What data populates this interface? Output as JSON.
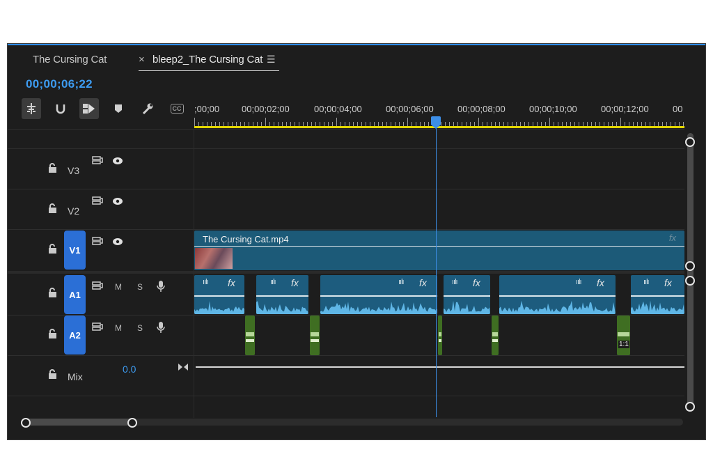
{
  "tabs": [
    {
      "label": "The Cursing Cat"
    },
    {
      "close": "×",
      "label": "bleep2_The Cursing Cat",
      "menu": "☰"
    }
  ],
  "timecode": "00;00;06;22",
  "toolbar": {
    "icons": [
      "insert-snap-icon",
      "magnet-icon",
      "linked-selection-icon",
      "marker-icon",
      "wrench-icon",
      "captions-icon"
    ],
    "cc_label": "CC"
  },
  "ruler": {
    "ticks": [
      ";00;00",
      "00;00;02;00",
      "00;00;04;00",
      "00;00;06;00",
      "00;00;08;00",
      "00;00;10;00",
      "00;00;12;00",
      "00"
    ]
  },
  "tracks": {
    "v3": {
      "name": "V3"
    },
    "v2": {
      "name": "V2"
    },
    "v1": {
      "name": "V1"
    },
    "a1": {
      "name": "A1",
      "m": "M",
      "s": "S"
    },
    "a2": {
      "name": "A2",
      "m": "M",
      "s": "S"
    },
    "mix": {
      "name": "Mix",
      "value": "0.0"
    }
  },
  "video_clip": {
    "name": "The Cursing Cat.mp4",
    "fx": "fx"
  },
  "audio_clip_fx": "fx",
  "audio_clip_badge": "1:1",
  "colors": {
    "accent": "#2d8ceb",
    "track_selected": "#2b6fd6",
    "clip_blue": "#1d5c7e",
    "clip_green": "#3f6e22",
    "work_area": "#e4d800"
  }
}
